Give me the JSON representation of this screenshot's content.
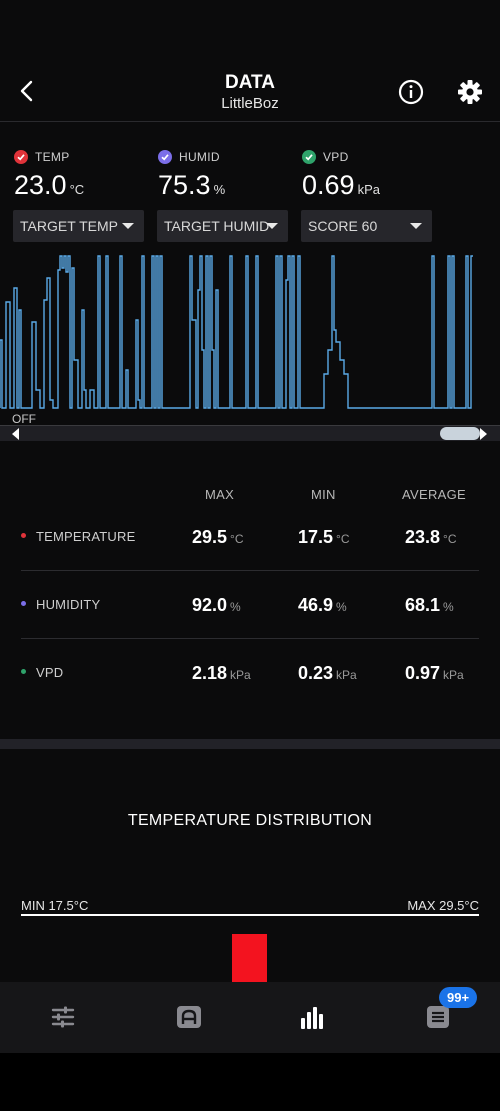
{
  "header": {
    "title": "DATA",
    "subtitle": "LittleBoz"
  },
  "readings": [
    {
      "label": "TEMP",
      "value": "23.0",
      "unit": "°C",
      "check_color": "#e0333a"
    },
    {
      "label": "HUMID",
      "value": "75.3",
      "unit": "%",
      "check_color": "#7b6ee8"
    },
    {
      "label": "VPD",
      "value": "0.69",
      "unit": "kPa",
      "check_color": "#2fa36b"
    }
  ],
  "dropdowns": [
    {
      "label": "TARGET TEMP"
    },
    {
      "label": "TARGET HUMID"
    },
    {
      "label": "SCORE 60"
    }
  ],
  "chart": {
    "off_label": "OFF",
    "line_color": "#5aa9e6"
  },
  "stats": {
    "headers": {
      "max": "MAX",
      "min": "MIN",
      "average": "AVERAGE"
    },
    "rows": [
      {
        "name": "TEMPERATURE",
        "dot_color": "#e0333a",
        "max": "29.5",
        "min": "17.5",
        "avg": "23.8",
        "unit": "°C"
      },
      {
        "name": "HUMIDITY",
        "dot_color": "#7b6ee8",
        "max": "92.0",
        "min": "46.9",
        "avg": "68.1",
        "unit": "%"
      },
      {
        "name": "VPD",
        "dot_color": "#2fa36b",
        "max": "2.18",
        "min": "0.23",
        "avg": "0.97",
        "unit": "kPa"
      }
    ]
  },
  "distribution": {
    "title": "TEMPERATURE DISTRIBUTION",
    "min_label": "MIN 17.5°C",
    "max_label": "MAX 29.5°C",
    "bar_color": "#f3131f"
  },
  "nav": {
    "items": [
      "sliders-icon",
      "auto-mode-icon",
      "bar-chart-icon",
      "log-list-icon"
    ],
    "badge": "99+"
  }
}
